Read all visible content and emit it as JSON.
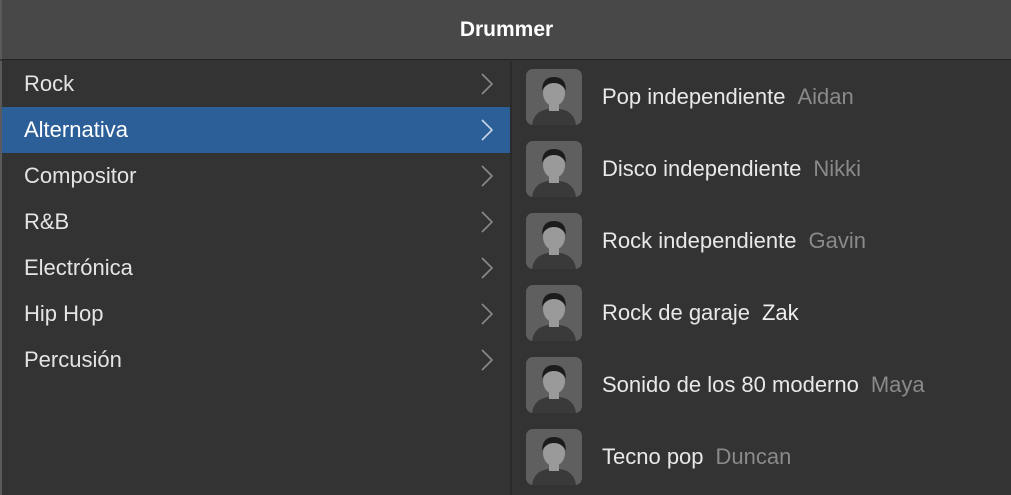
{
  "header": {
    "title": "Drummer"
  },
  "categories": [
    {
      "label": "Rock",
      "selected": false
    },
    {
      "label": "Alternativa",
      "selected": true
    },
    {
      "label": "Compositor",
      "selected": false
    },
    {
      "label": "R&B",
      "selected": false
    },
    {
      "label": "Electrónica",
      "selected": false
    },
    {
      "label": "Hip Hop",
      "selected": false
    },
    {
      "label": "Percusión",
      "selected": false
    }
  ],
  "drummers": [
    {
      "style": "Pop independiente",
      "name": "Aidan",
      "selected": false
    },
    {
      "style": "Disco independiente",
      "name": "Nikki",
      "selected": false
    },
    {
      "style": "Rock independiente",
      "name": "Gavin",
      "selected": false
    },
    {
      "style": "Rock de garaje",
      "name": "Zak",
      "selected": true
    },
    {
      "style": "Sonido de los 80 moderno",
      "name": "Maya",
      "selected": false
    },
    {
      "style": "Tecno pop",
      "name": "Duncan",
      "selected": false
    }
  ],
  "colors": {
    "selection": "#2c5f98"
  }
}
